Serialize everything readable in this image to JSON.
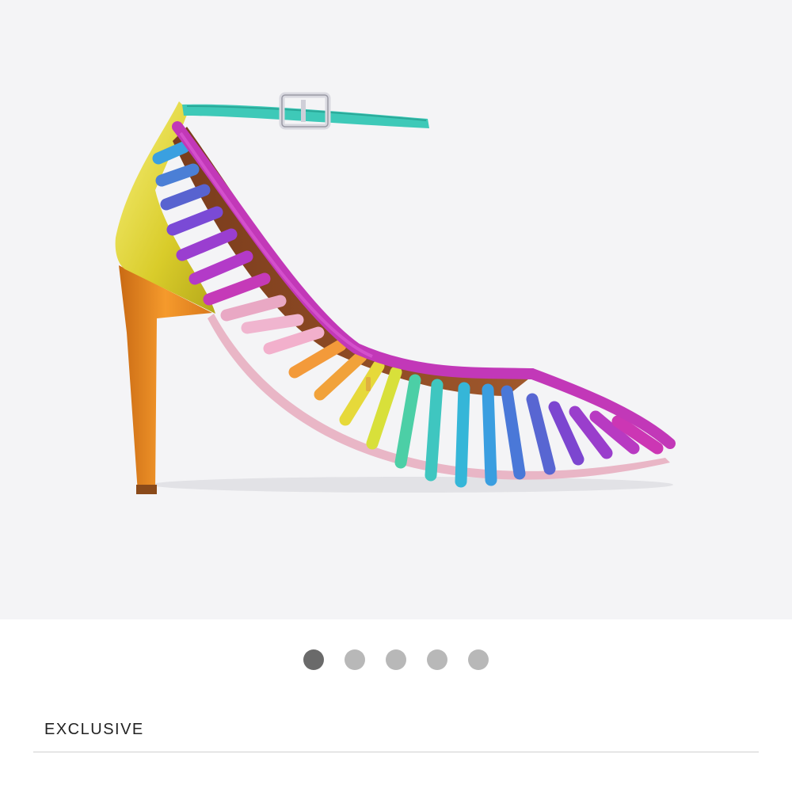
{
  "product": {
    "image_alt_icon": "rainbow-caged-pointed-heel-image",
    "badge": "EXCLUSIVE"
  },
  "carousel": {
    "total": 5,
    "active_index": 0
  }
}
